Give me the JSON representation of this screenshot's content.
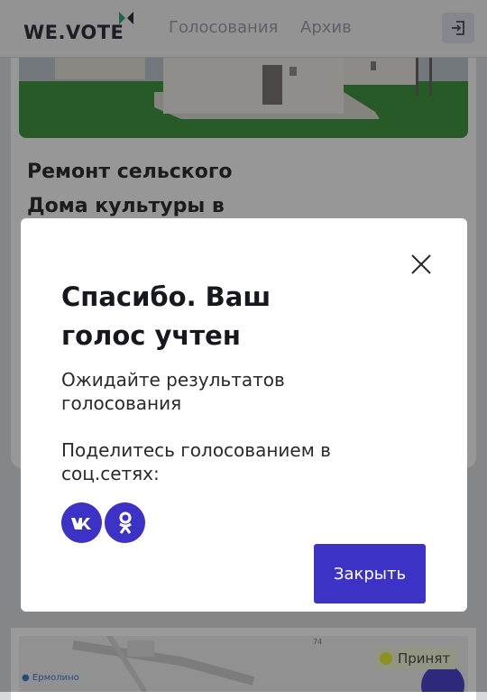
{
  "header": {
    "logo_text": "WE.VOTE",
    "nav": [
      "Голосования",
      "Архив"
    ],
    "logout_icon": "logout-icon"
  },
  "card": {
    "title": "Ремонт сельского Дома культуры в"
  },
  "map": {
    "status_badge": "Принят",
    "place_label": "Ермолино",
    "number_label": "74"
  },
  "modal": {
    "title": "Спасибо. Ваш голос учтен",
    "wait_text": "Ожидайте результатов голосования",
    "share_text": "Поделитесь голосованием в соц.сетях:",
    "social": [
      "vk-icon",
      "odnoklassniki-icon"
    ],
    "close_button": "Закрыть"
  },
  "colors": {
    "accent": "#3d32c6",
    "status_dot": "#e6ee26"
  }
}
